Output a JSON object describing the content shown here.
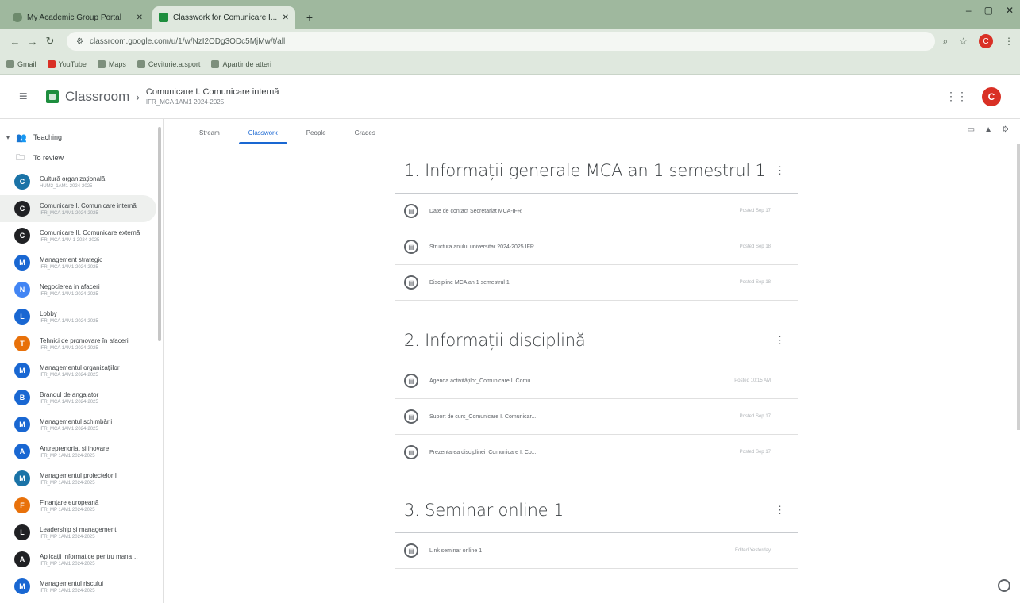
{
  "browser": {
    "tabs": [
      {
        "title": "My Academic Group Portal",
        "active": false
      },
      {
        "title": "Classwork for Comunicare I...",
        "active": true
      }
    ],
    "new_tab": "+",
    "window_controls": [
      "–",
      "▢",
      "✕"
    ],
    "url": "classroom.google.com/u/1/w/NzI2ODg3ODc5MjMw/t/all",
    "bookmarks": [
      "Gmail",
      "YouTube",
      "Maps",
      "Ceviturie.a.sport",
      "Apartir de atteri"
    ]
  },
  "header": {
    "app_name": "Classroom",
    "course_title": "Comunicare I. Comunicare internă",
    "course_subtitle": "IFR_MCA 1AM1 2024-2025",
    "avatar_letter": "C"
  },
  "sidebar": {
    "teaching_label": "Teaching",
    "to_review_label": "To review",
    "courses": [
      {
        "letter": "C",
        "name": "Cultură organizațională",
        "code": "HUM2_1AM1 2024-2025",
        "color": "#1a73a7",
        "selected": false
      },
      {
        "letter": "C",
        "name": "Comunicare I. Comunicare internă",
        "code": "IFR_MCA 1AM1 2024-2025",
        "color": "#202124",
        "selected": true
      },
      {
        "letter": "C",
        "name": "Comunicare II. Comunicare externă",
        "code": "IFR_MCA 1AM 1 2024-2025",
        "color": "#202124",
        "selected": false
      },
      {
        "letter": "M",
        "name": "Management strategic",
        "code": "IFR_MCA 1AM1 2024-2025",
        "color": "#1967d2",
        "selected": false
      },
      {
        "letter": "N",
        "name": "Negocierea in afaceri",
        "code": "IFR_MCA 1AM1 2024-2025",
        "color": "#4285f4",
        "selected": false
      },
      {
        "letter": "L",
        "name": "Lobby",
        "code": "IFR_MCA 1AM1 2024-2025",
        "color": "#1967d2",
        "selected": false
      },
      {
        "letter": "T",
        "name": "Tehnici de promovare în afaceri",
        "code": "IFR_MCA 1AM1 2024-2025",
        "color": "#e8710a",
        "selected": false
      },
      {
        "letter": "M",
        "name": "Managementul organizațiilor",
        "code": "IFR_MCA 1AM1 2024-2025",
        "color": "#1967d2",
        "selected": false
      },
      {
        "letter": "B",
        "name": "Brandul de angajator",
        "code": "IFR_MCA 1AM1 2024-2025",
        "color": "#1967d2",
        "selected": false
      },
      {
        "letter": "M",
        "name": "Managementul schimbării",
        "code": "IFR_MCA 1AM1 2024-2025",
        "color": "#1967d2",
        "selected": false
      },
      {
        "letter": "A",
        "name": "Antreprenoriat și inovare",
        "code": "IFR_MP 1AM1 2024-2025",
        "color": "#1967d2",
        "selected": false
      },
      {
        "letter": "M",
        "name": "Managementul proiectelor I",
        "code": "IFR_MP 1AM1 2024-2025",
        "color": "#1a73a7",
        "selected": false
      },
      {
        "letter": "F",
        "name": "Finanțare europeană",
        "code": "IFR_MP 1AM1 2024-2025",
        "color": "#e8710a",
        "selected": false
      },
      {
        "letter": "L",
        "name": "Leadership și management",
        "code": "IFR_MP 1AM1 2024-2025",
        "color": "#202124",
        "selected": false
      },
      {
        "letter": "A",
        "name": "Aplicații informatice pentru management",
        "code": "IFR_MP 1AM1 2024-2025",
        "color": "#202124",
        "selected": false
      },
      {
        "letter": "M",
        "name": "Managementul riscului",
        "code": "IFR_MP 1AM1 2024-2025",
        "color": "#1967d2",
        "selected": false
      }
    ]
  },
  "tabs": [
    {
      "label": "Stream",
      "active": false
    },
    {
      "label": "Classwork",
      "active": true
    },
    {
      "label": "People",
      "active": false
    },
    {
      "label": "Grades",
      "active": false
    }
  ],
  "topics": [
    {
      "title": "1. Informații generale MCA an 1 semestrul 1",
      "materials": [
        {
          "title": "Date de contact Secretariat MCA-IFR",
          "date": "Posted Sep 17"
        },
        {
          "title": "Structura anului universitar 2024-2025 IFR",
          "date": "Posted Sep 18"
        },
        {
          "title": "Discipline MCA an 1 semestrul 1",
          "date": "Posted Sep 18"
        }
      ]
    },
    {
      "title": "2. Informații disciplină",
      "materials": [
        {
          "title": "Agenda activităților_Comunicare I. Comu...",
          "date": "Posted 10:15 AM"
        },
        {
          "title": "Suport de curs_Comunicare I. Comunicar...",
          "date": "Posted Sep 17"
        },
        {
          "title": "Prezentarea disciplinei_Comunicare I. Co...",
          "date": "Posted Sep 17"
        }
      ]
    },
    {
      "title": "3. Seminar online 1",
      "materials": [
        {
          "title": "Link seminar online 1",
          "date": "Edited Yesterday"
        }
      ]
    }
  ]
}
